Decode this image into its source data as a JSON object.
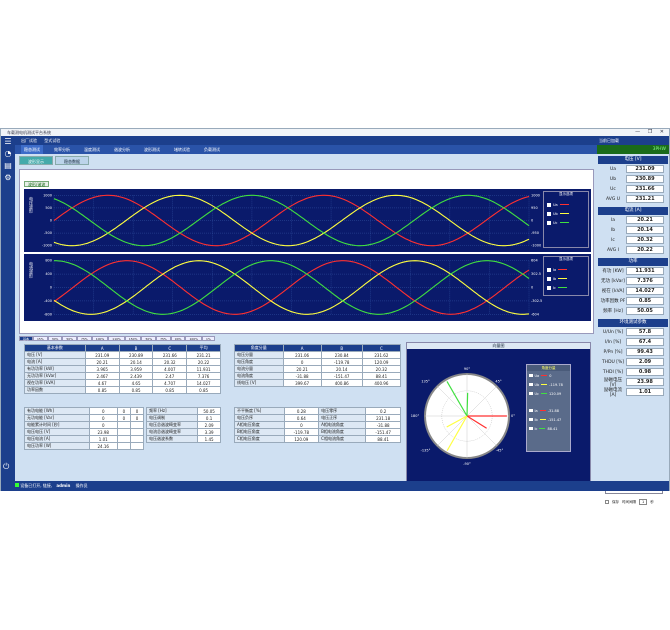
{
  "app": {
    "title": "车载测电机测试平台系统",
    "window_controls": "— ❐ ✕"
  },
  "topbar": {
    "items": [
      "出厂试验",
      "型式试验"
    ],
    "right": "当前已加载"
  },
  "menubar": {
    "items": [
      "稳态测试",
      "效率分析",
      "温度测试",
      "谐波分析",
      "波形测试",
      "堵转试验",
      "负载测试"
    ],
    "active": 0,
    "status": "3PHW"
  },
  "tabs": [
    "波形显示",
    "稳态数据"
  ],
  "chart": {
    "mode_btn": "波形/谐波",
    "volt_ylabel": "电压波形",
    "curr_ylabel": "电流波形",
    "volt_ticks_left": [
      "1000",
      "500",
      "0",
      "-500",
      "-1000"
    ],
    "volt_ticks_right": [
      "1000",
      "950",
      "0",
      "-950",
      "-1000"
    ],
    "curr_ticks_left": [
      "800",
      "400",
      "0",
      "-400",
      "-800"
    ],
    "curr_ticks_right": [
      "604",
      "302.5",
      "0",
      "-302.5",
      "-604"
    ],
    "legend_title": "显示选项"
  },
  "chart_data": {
    "type": "line",
    "series": [
      {
        "name": "Ua",
        "color": "#ff3030"
      },
      {
        "name": "Ub",
        "color": "#ffff40"
      },
      {
        "name": "Uc",
        "color": "#40e040"
      },
      {
        "name": "Ia",
        "color": "#ff3030"
      },
      {
        "name": "Ib",
        "color": "#ffff40"
      },
      {
        "name": "Ic",
        "color": "#40e040"
      }
    ]
  },
  "bottom_tabs": [
    "基本",
    "15%",
    "30%",
    "50%",
    "75%",
    "100%",
    "110%",
    "150%",
    "50%",
    "75%",
    "90%",
    "100%",
    "1%"
  ],
  "main_table": {
    "headers": [
      "基本参数",
      "A",
      "B",
      "C",
      "平均"
    ],
    "rows": [
      [
        "电压 [V]",
        "231.09",
        "230.89",
        "231.66",
        "231.21"
      ],
      [
        "电流 [A]",
        "20.21",
        "20.14",
        "20.32",
        "20.22"
      ],
      [
        "有功功率 [kW]",
        "3.965",
        "3.959",
        "4.007",
        "11.931"
      ],
      [
        "无功功率 [kVar]",
        "2.467",
        "2.439",
        "2.47",
        "7.376"
      ],
      [
        "视在功率 [kVA]",
        "4.67",
        "4.65",
        "4.707",
        "14.027"
      ],
      [
        "功率因数",
        "0.85",
        "0.85",
        "0.85",
        "0.85"
      ]
    ]
  },
  "angle_table": {
    "headers": [
      "角度分量",
      "A",
      "B",
      "C"
    ],
    "rows": [
      [
        "电压分量",
        "231.06",
        "230.84",
        "231.62"
      ],
      [
        "电压角度",
        "0",
        "-119.78",
        "120.09"
      ],
      [
        "电流分量",
        "20.21",
        "20.14",
        "20.32"
      ],
      [
        "电流角度",
        "-31.88",
        "-151.47",
        "88.41"
      ],
      [
        "线电压 [V]",
        "399.67",
        "400.86",
        "400.96"
      ]
    ]
  },
  "extra1": [
    [
      "有功电能 [Wh]",
      "0",
      "0",
      "0"
    ],
    [
      "无功电能 [Var]",
      "0",
      "0",
      "0"
    ],
    [
      "电能累计时间 [秒]",
      "0",
      "",
      ""
    ],
    [
      "电压电压 [V]",
      "23.98",
      "",
      ""
    ],
    [
      "电压电流 [A]",
      "1.01",
      "",
      ""
    ],
    [
      "电压功率 [W]",
      "24.16",
      "",
      ""
    ]
  ],
  "extra2": [
    [
      "频率 [Hz]",
      "50.05"
    ],
    [
      "电压调制",
      "0.1"
    ],
    [
      "电压总谐波畸变率",
      "2.09"
    ],
    [
      "电流总谐波畸变率",
      "3.39"
    ],
    [
      "电压谐波系数",
      "1.45"
    ]
  ],
  "extra3": [
    [
      "不平衡度 [%]",
      "0.28",
      "电压零序",
      "0.2"
    ],
    [
      "电压负序",
      "0.64",
      "电压正序",
      "231.18"
    ],
    [
      "A相电压角度",
      "0",
      "A相电流角度",
      "-31.88"
    ],
    [
      "B相电压角度",
      "-119.78",
      "B相电流角度",
      "-151.47"
    ],
    [
      "C相电压角度",
      "120.09",
      "C相电流角度",
      "88.41"
    ]
  ],
  "vector": {
    "title": "向量图",
    "legend_title": "角度分量",
    "degrees": [
      "90°",
      "45°",
      "0°",
      "-45°",
      "-90°",
      "-135°",
      "180°",
      "135°"
    ],
    "legend": [
      [
        "Ua",
        "0"
      ],
      [
        "Ub",
        "-119.78"
      ],
      [
        "Uc",
        "120.09"
      ],
      [
        "Ia",
        "-31.88"
      ],
      [
        "Ib",
        "-151.47"
      ],
      [
        "Ic",
        "88.41"
      ]
    ]
  },
  "right": {
    "voltage_head": "电压 [V]",
    "voltage": [
      [
        "Ua",
        "231.09"
      ],
      [
        "Ub",
        "230.89"
      ],
      [
        "Uc",
        "231.66"
      ],
      [
        "AVG U",
        "231.21"
      ]
    ],
    "current_head": "电流 [A]",
    "current": [
      [
        "Ia",
        "20.21"
      ],
      [
        "Ib",
        "20.14"
      ],
      [
        "Ic",
        "20.32"
      ],
      [
        "AVG I",
        "20.22"
      ]
    ],
    "power_head": "功率",
    "power": [
      [
        "有功 [KW]",
        "11.931"
      ],
      [
        "无功 [kVar]",
        "7.376"
      ],
      [
        "视在 [kVA]",
        "14.027"
      ],
      [
        "功率因数 PF",
        "0.85"
      ],
      [
        "频率 [Hz]",
        "50.05"
      ]
    ],
    "env_head": "环境测试参数",
    "env": [
      [
        "U/Un [%]",
        "57.8"
      ],
      [
        "I/In [%]",
        "67.4"
      ],
      [
        "P/Pn [%]",
        "99.43"
      ],
      [
        "THDU [%]",
        "2.09"
      ],
      [
        "THDI [%]",
        "0.98"
      ],
      [
        "励磁电压 [V]",
        "23.98"
      ],
      [
        "励磁电流 [A]",
        "1.01"
      ]
    ],
    "test_btn": "任测数据",
    "save_label": "保存",
    "time_label": "时间间隔",
    "time_value": "1",
    "time_unit": "秒"
  },
  "footer": {
    "status": "设备已打开, 链接, ",
    "user": "admin",
    "role": "操作员"
  }
}
